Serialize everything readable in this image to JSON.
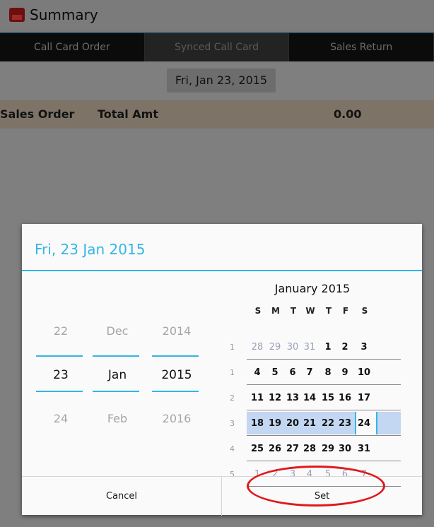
{
  "app": {
    "title": "Summary",
    "icon": "app-icon"
  },
  "tabs": [
    {
      "label": "Call Card Order"
    },
    {
      "label": "Synced Call Card"
    },
    {
      "label": "Sales Return"
    }
  ],
  "date_chip": "Fri, Jan 23, 2015",
  "summary": {
    "col1": "Sales Order",
    "col2": "Total Amt",
    "amount": "0.00"
  },
  "dialog": {
    "title": "Fri, 23 Jan 2015",
    "spinners": {
      "day": {
        "prev": "22",
        "current": "23",
        "next": "24"
      },
      "month": {
        "prev": "Dec",
        "current": "Jan",
        "next": "Feb"
      },
      "year": {
        "prev": "2014",
        "current": "2015",
        "next": "2016"
      }
    },
    "calendar": {
      "month_label": "January 2015",
      "dow": [
        "S",
        "M",
        "T",
        "W",
        "T",
        "F",
        "S"
      ],
      "weeks": [
        {
          "num": "1",
          "days": [
            "28",
            "29",
            "30",
            "31",
            "1",
            "2",
            "3"
          ],
          "dim": [
            true,
            true,
            true,
            true,
            false,
            false,
            false
          ]
        },
        {
          "num": "1",
          "days": [
            "4",
            "5",
            "6",
            "7",
            "8",
            "9",
            "10"
          ],
          "dim": [
            false,
            false,
            false,
            false,
            false,
            false,
            false
          ]
        },
        {
          "num": "2",
          "days": [
            "11",
            "12",
            "13",
            "14",
            "15",
            "16",
            "17"
          ],
          "dim": [
            false,
            false,
            false,
            false,
            false,
            false,
            false
          ]
        },
        {
          "num": "3",
          "days": [
            "18",
            "19",
            "20",
            "21",
            "22",
            "23",
            "24"
          ],
          "dim": [
            false,
            false,
            false,
            false,
            false,
            false,
            false
          ]
        },
        {
          "num": "4",
          "days": [
            "25",
            "26",
            "27",
            "28",
            "29",
            "30",
            "31"
          ],
          "dim": [
            false,
            false,
            false,
            false,
            false,
            false,
            false
          ]
        },
        {
          "num": "5",
          "days": [
            "1",
            "2",
            "3",
            "4",
            "5",
            "6",
            "7"
          ],
          "dim": [
            true,
            true,
            true,
            true,
            true,
            true,
            true
          ]
        }
      ],
      "selected": "23"
    },
    "buttons": {
      "cancel": "Cancel",
      "set": "Set"
    }
  },
  "colors": {
    "accent": "#33b5e5",
    "highlight_week": "#c3d6f2",
    "annotation": "#e0191c"
  }
}
